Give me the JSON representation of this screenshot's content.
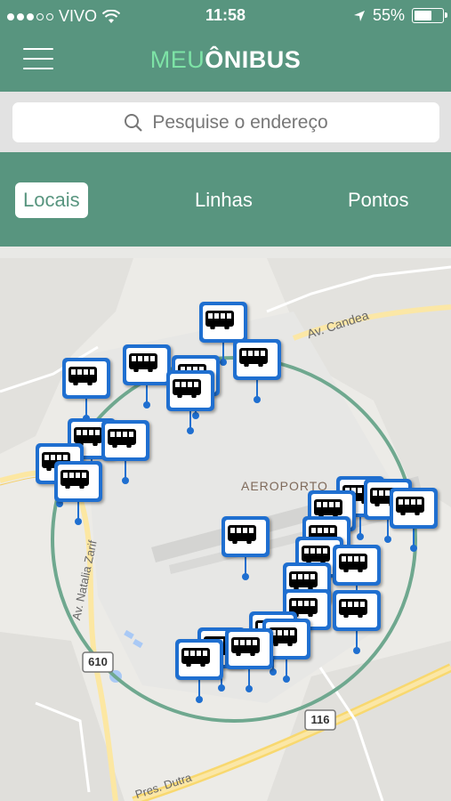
{
  "status": {
    "carrier": "VIVO",
    "time": "11:58",
    "battery": "55%",
    "battery_level": 0.55
  },
  "header": {
    "logo_light": "MEU",
    "logo_bold": "ÔNIBUS"
  },
  "search": {
    "placeholder": "Pesquise o endereço"
  },
  "tabs": [
    {
      "label": "Locais",
      "active": true
    },
    {
      "label": "Linhas",
      "active": false
    },
    {
      "label": "Pontos",
      "active": false
    }
  ],
  "map": {
    "labels": {
      "area": "AEROPORTO",
      "street1": "Av. Candea",
      "street2": "Av. Natalia Zarif",
      "road1": "Pres. Dutra",
      "shield1": "610",
      "shield2": "116"
    },
    "radius_color": "#5fa58c",
    "pin_color": "#1f6fd0"
  }
}
